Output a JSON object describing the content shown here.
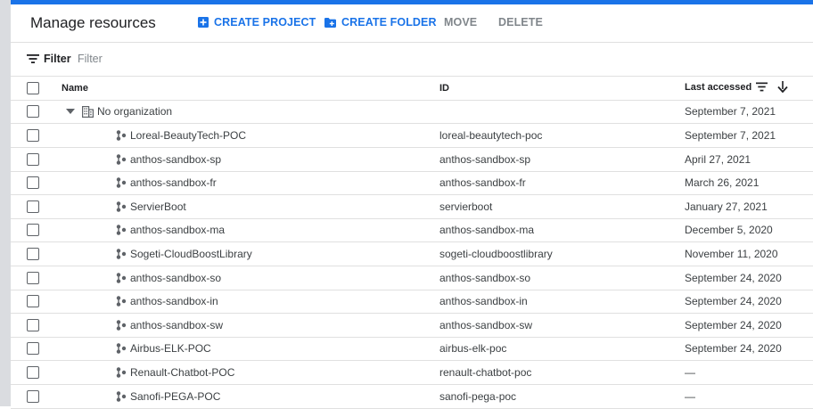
{
  "title": "Manage resources",
  "toolbar": {
    "create_project": "CREATE PROJECT",
    "create_folder": "CREATE FOLDER",
    "move": "MOVE",
    "delete": "DELETE"
  },
  "filter": {
    "label": "Filter",
    "placeholder": "Filter"
  },
  "columns": {
    "name": "Name",
    "id": "ID",
    "last_accessed": "Last accessed"
  },
  "org_row": {
    "name": "No organization",
    "last_accessed": "September 7, 2021"
  },
  "rows": [
    {
      "name": "Loreal-BeautyTech-POC",
      "id": "loreal-beautytech-poc",
      "last_accessed": "September 7, 2021"
    },
    {
      "name": "anthos-sandbox-sp",
      "id": "anthos-sandbox-sp",
      "last_accessed": "April 27, 2021"
    },
    {
      "name": "anthos-sandbox-fr",
      "id": "anthos-sandbox-fr",
      "last_accessed": "March 26, 2021"
    },
    {
      "name": "ServierBoot",
      "id": "servierboot",
      "last_accessed": "January 27, 2021"
    },
    {
      "name": "anthos-sandbox-ma",
      "id": "anthos-sandbox-ma",
      "last_accessed": "December 5, 2020"
    },
    {
      "name": "Sogeti-CloudBoostLibrary",
      "id": "sogeti-cloudboostlibrary",
      "last_accessed": "November 11, 2020"
    },
    {
      "name": "anthos-sandbox-so",
      "id": "anthos-sandbox-so",
      "last_accessed": "September 24, 2020"
    },
    {
      "name": "anthos-sandbox-in",
      "id": "anthos-sandbox-in",
      "last_accessed": "September 24, 2020"
    },
    {
      "name": "anthos-sandbox-sw",
      "id": "anthos-sandbox-sw",
      "last_accessed": "September 24, 2020"
    },
    {
      "name": "Airbus-ELK-POC",
      "id": "airbus-elk-poc",
      "last_accessed": "September 24, 2020"
    },
    {
      "name": "Renault-Chatbot-POC",
      "id": "renault-chatbot-poc",
      "last_accessed": "—"
    },
    {
      "name": "Sanofi-PEGA-POC",
      "id": "sanofi-pega-poc",
      "last_accessed": "—"
    }
  ],
  "icons": {
    "create_project": "add-box-icon",
    "create_folder": "create-folder-icon",
    "filter": "filter-list-icon",
    "sort_filter": "filter-list-icon",
    "sort_direction": "arrow-down-icon",
    "expand": "triangle-down-icon",
    "organization": "building-icon",
    "project": "project-hexagon-icon"
  },
  "colors": {
    "accent": "#1a73e8",
    "disabled": "#80868b",
    "text": "#202124",
    "divider": "#e0e0e0"
  }
}
